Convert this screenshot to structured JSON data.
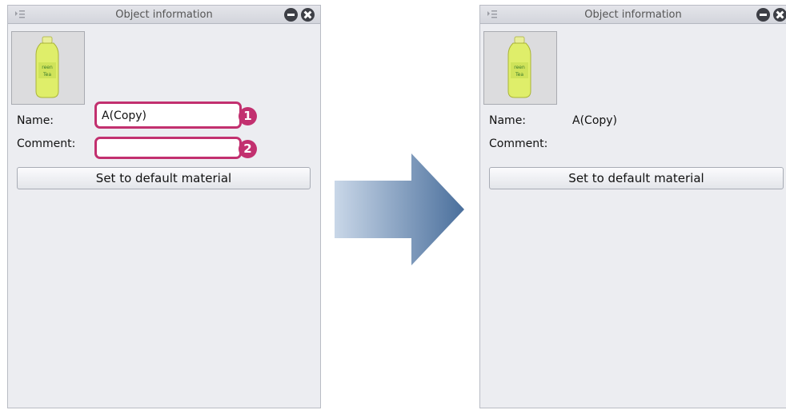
{
  "before_panel": {
    "title": "Object information",
    "name_label": "Name:",
    "name_value": "A(Copy)",
    "comment_label": "Comment:",
    "comment_value": "",
    "button_label": "Set to default material",
    "callouts": [
      "1",
      "2"
    ],
    "thumbnail_icon": "green-tea-bottle-icon"
  },
  "after_panel": {
    "title": "Object information",
    "name_label": "Name:",
    "name_value": "A(Copy)",
    "comment_label": "Comment:",
    "button_label": "Set to default material",
    "thumbnail_icon": "green-tea-bottle-icon"
  },
  "colors": {
    "highlight": "#c2306f",
    "arrow_start": "#c9d7e8",
    "arrow_end": "#4a6f9c",
    "panel_bg": "#ecedf1"
  },
  "icons": [
    "panel-menu-icon",
    "minimize-icon",
    "close-icon",
    "arrow-right-icon"
  ]
}
